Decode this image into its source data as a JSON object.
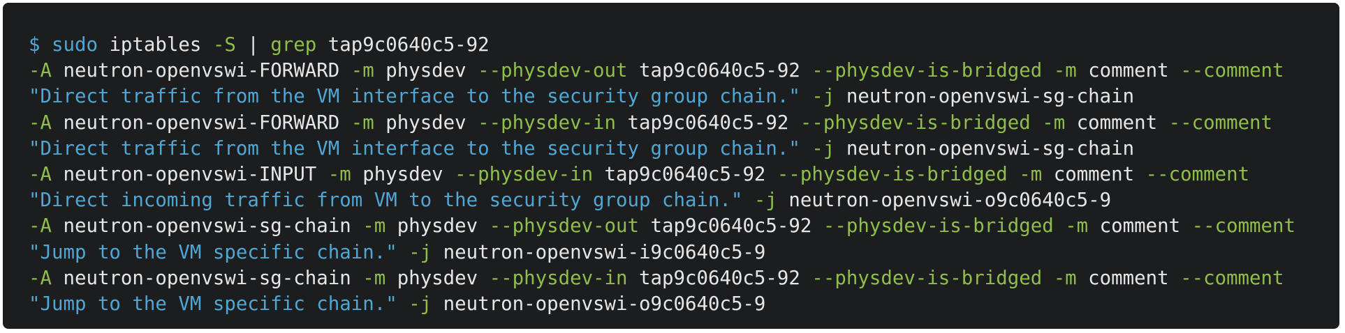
{
  "terminal": {
    "lines": [
      [
        {
          "text": "$ sudo",
          "color": "b"
        },
        {
          "text": " iptables ",
          "color": "w"
        },
        {
          "text": "-S",
          "color": "g"
        },
        {
          "text": " | ",
          "color": "w"
        },
        {
          "text": "grep",
          "color": "g"
        },
        {
          "text": " tap9c0640c5-92",
          "color": "w"
        }
      ],
      [
        {
          "text": "-A",
          "color": "g"
        },
        {
          "text": " neutron-openvswi-FORWARD ",
          "color": "w"
        },
        {
          "text": "-m",
          "color": "g"
        },
        {
          "text": " physdev ",
          "color": "w"
        },
        {
          "text": "--physdev-out",
          "color": "g"
        },
        {
          "text": " tap9c0640c5-92 ",
          "color": "w"
        },
        {
          "text": "--physdev-is-bridged -m",
          "color": "g"
        },
        {
          "text": " comment ",
          "color": "w"
        },
        {
          "text": "--comment",
          "color": "g"
        }
      ],
      [
        {
          "text": "\"Direct traffic from the VM interface to the security group chain.\"",
          "color": "b"
        },
        {
          "text": " -j",
          "color": "g"
        },
        {
          "text": " neutron-openvswi-sg-chain",
          "color": "w"
        }
      ],
      [
        {
          "text": "-A",
          "color": "g"
        },
        {
          "text": " neutron-openvswi-FORWARD ",
          "color": "w"
        },
        {
          "text": "-m",
          "color": "g"
        },
        {
          "text": " physdev ",
          "color": "w"
        },
        {
          "text": "--physdev-in",
          "color": "g"
        },
        {
          "text": " tap9c0640c5-92 ",
          "color": "w"
        },
        {
          "text": "--physdev-is-bridged -m",
          "color": "g"
        },
        {
          "text": " comment ",
          "color": "w"
        },
        {
          "text": "--comment",
          "color": "g"
        }
      ],
      [
        {
          "text": "\"Direct traffic from the VM interface to the security group chain.\"",
          "color": "b"
        },
        {
          "text": " -j",
          "color": "g"
        },
        {
          "text": " neutron-openvswi-sg-chain",
          "color": "w"
        }
      ],
      [
        {
          "text": "-A",
          "color": "g"
        },
        {
          "text": " neutron-openvswi-INPUT ",
          "color": "w"
        },
        {
          "text": "-m",
          "color": "g"
        },
        {
          "text": " physdev ",
          "color": "w"
        },
        {
          "text": "--physdev-in",
          "color": "g"
        },
        {
          "text": " tap9c0640c5-92 ",
          "color": "w"
        },
        {
          "text": "--physdev-is-bridged -m",
          "color": "g"
        },
        {
          "text": " comment ",
          "color": "w"
        },
        {
          "text": "--comment",
          "color": "g"
        }
      ],
      [
        {
          "text": "\"Direct incoming traffic from VM to the security group chain.\"",
          "color": "b"
        },
        {
          "text": " -j",
          "color": "g"
        },
        {
          "text": " neutron-openvswi-o9c0640c5-9",
          "color": "w"
        }
      ],
      [
        {
          "text": "-A",
          "color": "g"
        },
        {
          "text": " neutron-openvswi-sg-chain ",
          "color": "w"
        },
        {
          "text": "-m",
          "color": "g"
        },
        {
          "text": " physdev ",
          "color": "w"
        },
        {
          "text": "--physdev-out",
          "color": "g"
        },
        {
          "text": " tap9c0640c5-92 ",
          "color": "w"
        },
        {
          "text": "--physdev-is-bridged -m",
          "color": "g"
        },
        {
          "text": " comment ",
          "color": "w"
        },
        {
          "text": "--comment",
          "color": "g"
        }
      ],
      [
        {
          "text": "\"Jump to the VM specific chain.\"",
          "color": "b"
        },
        {
          "text": " -j",
          "color": "g"
        },
        {
          "text": " neutron-openvswi-i9c0640c5-9",
          "color": "w"
        }
      ],
      [
        {
          "text": "-A",
          "color": "g"
        },
        {
          "text": " neutron-openvswi-sg-chain ",
          "color": "w"
        },
        {
          "text": "-m",
          "color": "g"
        },
        {
          "text": " physdev ",
          "color": "w"
        },
        {
          "text": "--physdev-in",
          "color": "g"
        },
        {
          "text": " tap9c0640c5-92 ",
          "color": "w"
        },
        {
          "text": "--physdev-is-bridged -m",
          "color": "g"
        },
        {
          "text": " comment ",
          "color": "w"
        },
        {
          "text": "--comment",
          "color": "g"
        }
      ],
      [
        {
          "text": "\"Jump to the VM specific chain.\"",
          "color": "b"
        },
        {
          "text": " -j",
          "color": "g"
        },
        {
          "text": " neutron-openvswi-o9c0640c5-9",
          "color": "w"
        }
      ]
    ]
  }
}
